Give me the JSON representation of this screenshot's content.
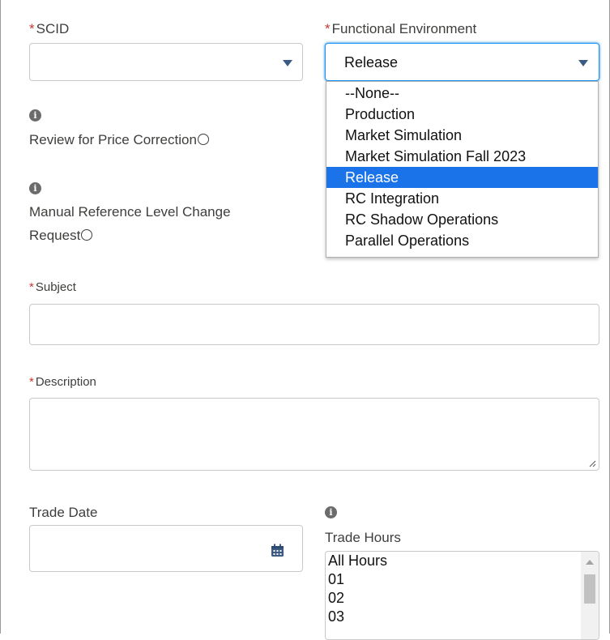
{
  "scid": {
    "required_mark": "*",
    "label": "SCID",
    "value": ""
  },
  "functional_environment": {
    "required_mark": "*",
    "label": "Functional Environment",
    "value": "Release",
    "options": [
      "--None--",
      "Production",
      "Market Simulation",
      "Market Simulation Fall 2023",
      "Release",
      "RC Integration",
      "RC Shadow Operations",
      "Parallel Operations"
    ],
    "selected_index": 4
  },
  "review_price_correction": {
    "label": "Review for Price Correction"
  },
  "manual_reference": {
    "label_line1": "Manual Reference Level Change",
    "label_line2": "Request"
  },
  "subject": {
    "required_mark": "*",
    "label": "Subject",
    "value": ""
  },
  "description": {
    "required_mark": "*",
    "label": "Description",
    "value": ""
  },
  "trade_date": {
    "label": "Trade Date",
    "value": ""
  },
  "trade_hours": {
    "label": "Trade Hours",
    "items": [
      "All Hours",
      "01",
      "02",
      "03"
    ]
  },
  "icons": {
    "info": "info-icon",
    "calendar": "calendar-icon",
    "dropdown": "chevron-down-icon"
  },
  "colors": {
    "required": "#c23934",
    "selected_option": "#1a73e8",
    "focus_border": "#1b96ff",
    "dropdown_arrow": "#3b5a84"
  }
}
